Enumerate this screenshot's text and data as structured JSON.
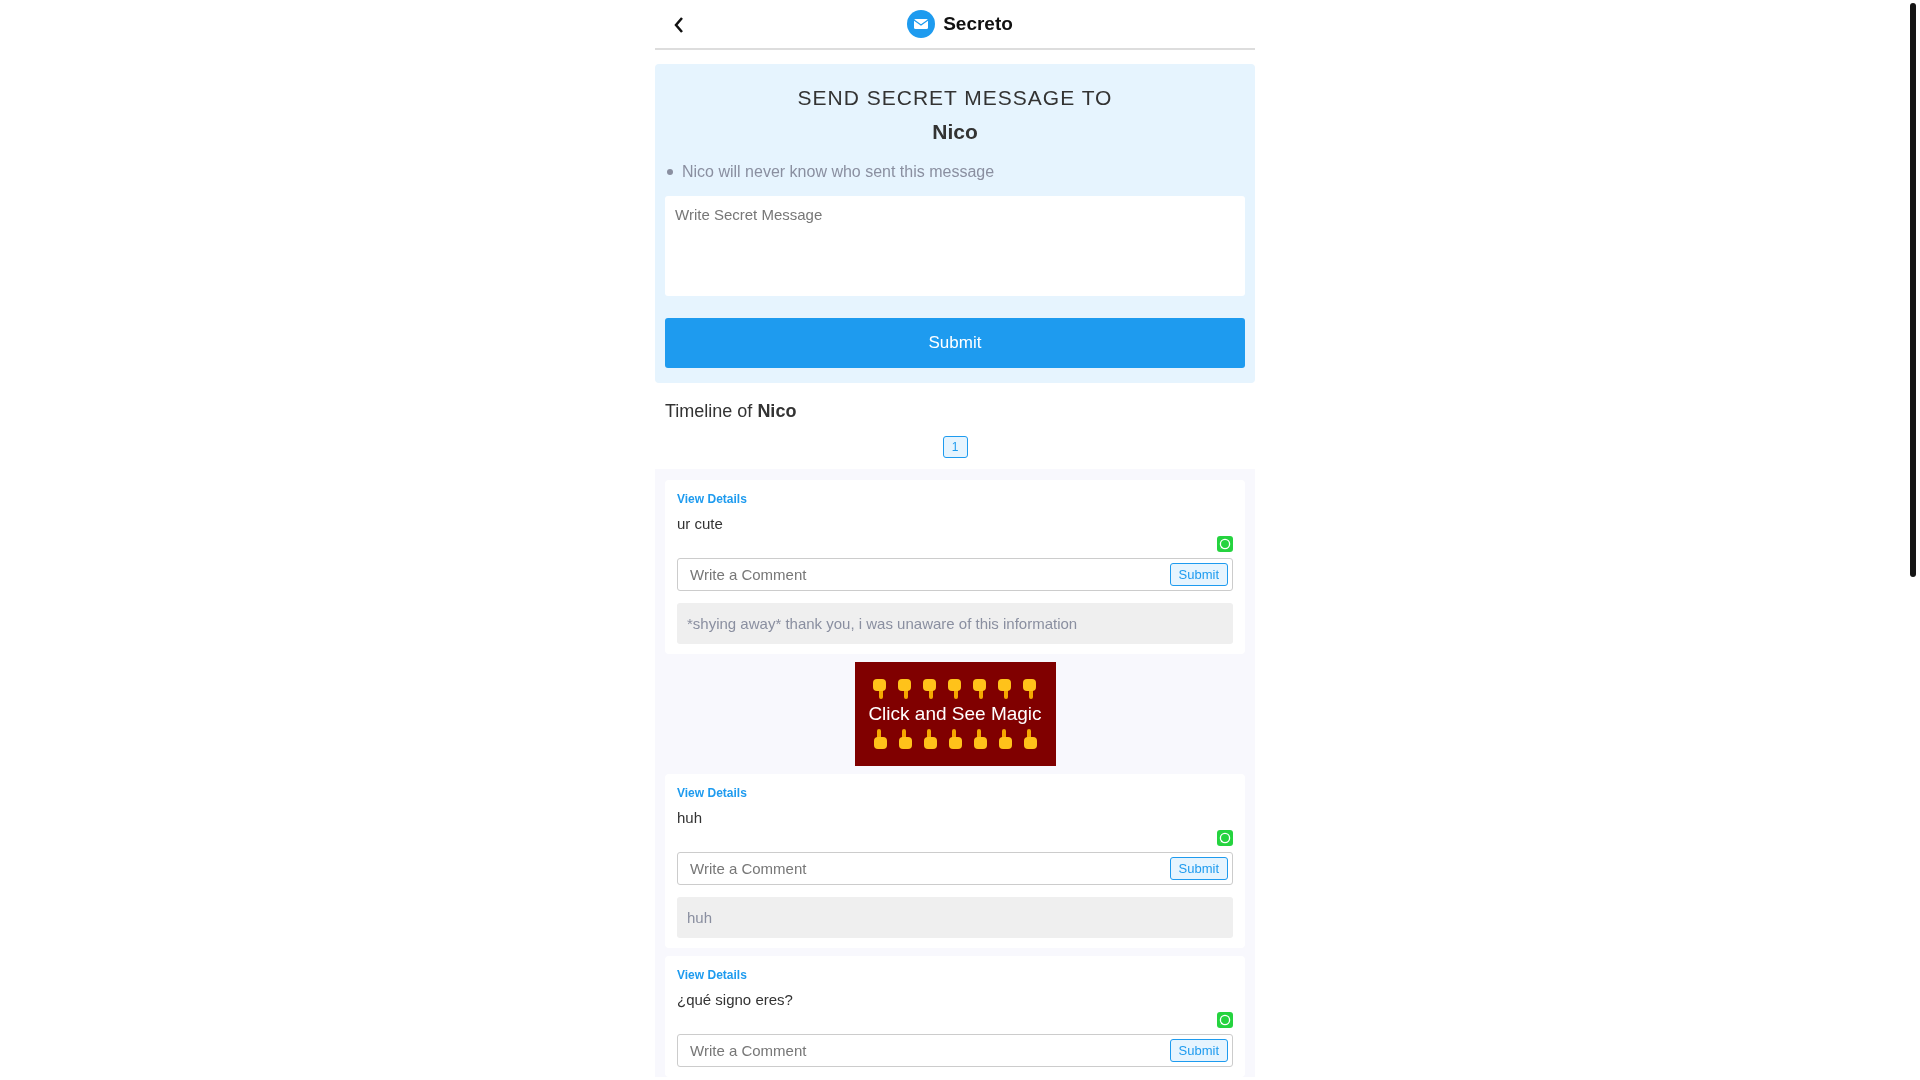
{
  "header": {
    "title": "Secreto"
  },
  "form": {
    "heading": "SEND SECRET MESSAGE TO",
    "name": "Nico",
    "notes": [
      "Nico will never know who sent this message"
    ],
    "message_field": {
      "placeholder": "Write Secret Message"
    },
    "submit": "Submit"
  },
  "timeline": {
    "title": "Timeline of **Nico**",
    "pages": [
      {
        "label": "1",
        "selected": true
      }
    ],
    "items": [
      {
        "kind": "post",
        "link": "View Details",
        "message": "ur cute",
        "comment_field": {
          "placeholder": "Write a Comment"
        },
        "comment_submit": "Submit",
        "reply": "*shying away* thank you, i was unaware of this information"
      },
      {
        "kind": "banner",
        "text": "Click and See Magic"
      },
      {
        "kind": "post",
        "link": "View Details",
        "message": "huh",
        "comment_field": {
          "placeholder": "Write a Comment"
        },
        "comment_submit": "Submit",
        "reply": "huh"
      },
      {
        "kind": "post",
        "link": "View Details",
        "message": "¿qué signo eres?",
        "comment_field": {
          "placeholder": "Write a Comment"
        },
        "comment_submit": "Submit"
      }
    ]
  }
}
